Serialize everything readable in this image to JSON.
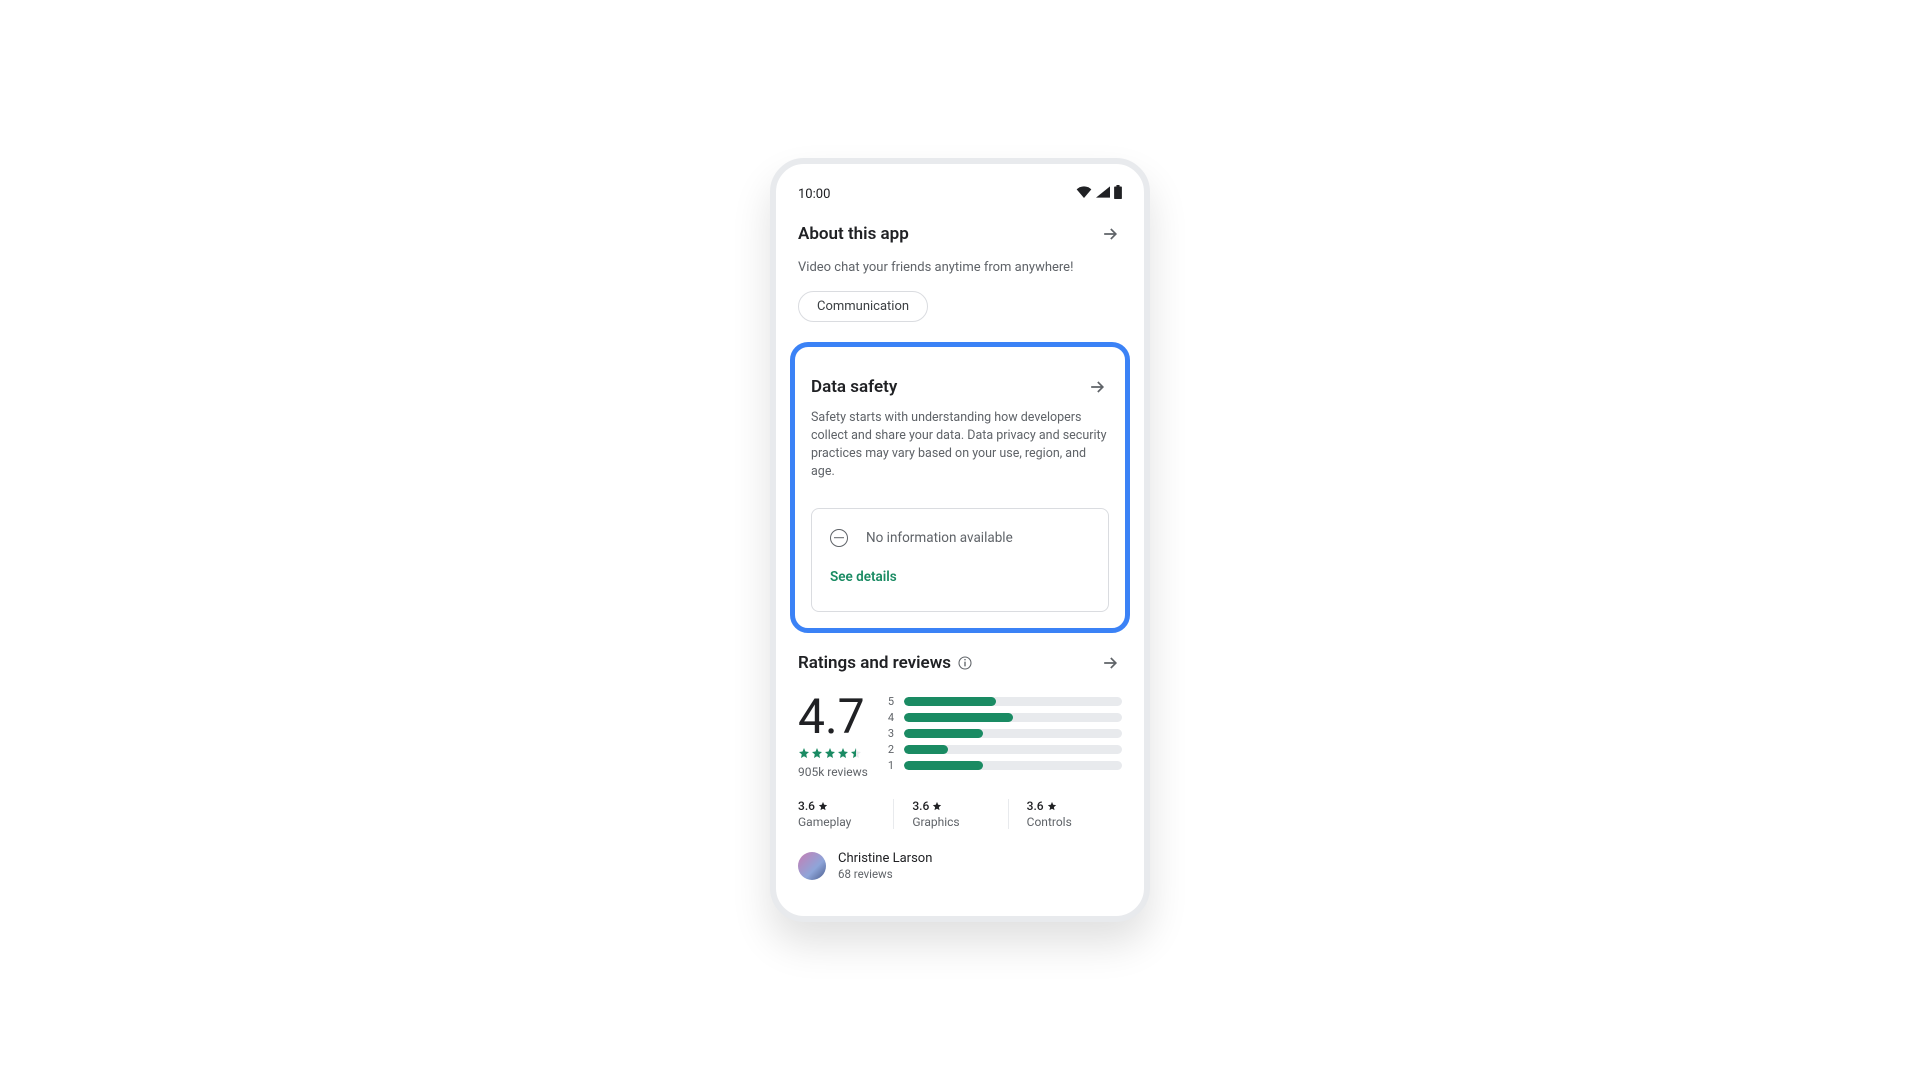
{
  "status": {
    "time": "10:00"
  },
  "about": {
    "title": "About this app",
    "description": "Video chat your friends anytime from anywhere!",
    "category_chip": "Communication"
  },
  "data_safety": {
    "title": "Data safety",
    "description": "Safety starts with understanding how developers collect and share your data. Data privacy and security practices may vary based on your use, region, and age.",
    "info_line": "No information available",
    "see_details": "See details"
  },
  "ratings": {
    "title": "Ratings and reviews",
    "average": "4.7",
    "review_count": "905k  reviews",
    "bars": [
      {
        "label": "5",
        "pct": 42
      },
      {
        "label": "4",
        "pct": 50
      },
      {
        "label": "3",
        "pct": 36
      },
      {
        "label": "2",
        "pct": 20
      },
      {
        "label": "1",
        "pct": 36
      }
    ],
    "aspects": [
      {
        "score": "3.6",
        "label": "Gameplay"
      },
      {
        "score": "3.6",
        "label": "Graphics"
      },
      {
        "score": "3.6",
        "label": "Controls"
      }
    ],
    "reviewer": {
      "name": "Christine Larson",
      "sub": "68 reviews"
    }
  }
}
